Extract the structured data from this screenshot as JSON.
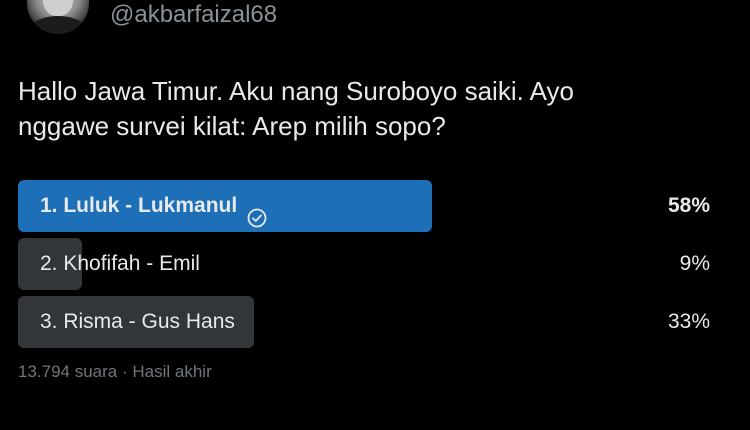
{
  "account": {
    "handle": "@akbarfaizal68"
  },
  "tweet": {
    "lines": [
      "Hallo Jawa Timur. Aku nang Suroboyo saiki. Ayo",
      "nggawe survei kilat: Arep milih sopo?"
    ]
  },
  "poll": {
    "options": [
      {
        "label": "1. Luluk - Lukmanul",
        "percent_label": "58%",
        "percent": 58,
        "winner": true,
        "check_icon": "check-circle-icon"
      },
      {
        "label": "2. Khofifah - Emil",
        "percent_label": "9%",
        "percent": 9,
        "winner": false
      },
      {
        "label": "3. Risma - Gus Hans",
        "percent_label": "33%",
        "percent": 33,
        "winner": false
      }
    ],
    "votes": "13.794 suara",
    "separator": "·",
    "status": "Hasil akhir"
  },
  "colors": {
    "background": "#000000",
    "winner_bar": "#1d6fb8",
    "other_bar": "#333639",
    "text": "#e7e9ea",
    "muted": "#71767b"
  }
}
